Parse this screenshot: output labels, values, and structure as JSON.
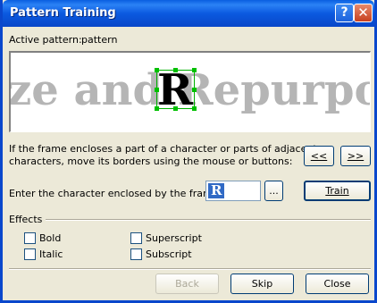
{
  "window": {
    "title": "Pattern Training",
    "help_label": "?",
    "close_label": "✕"
  },
  "pattern": {
    "active_label": "Active pattern:",
    "active_value": "pattern"
  },
  "preview": {
    "sample_text": "ze and Repurpos",
    "framed_char": "R"
  },
  "instructions": {
    "line1": "If the frame encloses a part of a character or parts of adjacent",
    "line2": "characters, move its borders using the mouse or buttons:"
  },
  "nav": {
    "prev_label": "<<",
    "next_label": ">>"
  },
  "entry": {
    "label": "Enter the character enclosed by the frame:",
    "value": "R",
    "browse_label": "...",
    "train_label": "Train"
  },
  "effects": {
    "title": "Effects",
    "options": [
      {
        "label": "Bold",
        "checked": false
      },
      {
        "label": "Italic",
        "checked": false
      },
      {
        "label": "Superscript",
        "checked": false
      },
      {
        "label": "Subscript",
        "checked": false
      }
    ]
  },
  "footer": {
    "back_label": "Back",
    "back_enabled": false,
    "skip_label": "Skip",
    "close_label": "Close"
  }
}
